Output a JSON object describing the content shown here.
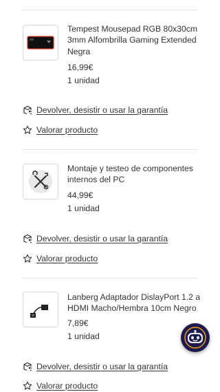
{
  "orders": [
    {
      "name": "Tempest Mousepad RGB 80x30cm 3mm Alfombrilla Gaming Extended Negra",
      "price": "16,99€",
      "quantity": "1 unidad",
      "image": "mousepad-image",
      "return_label": "Devolver, desistir o usar la garantía",
      "review_label": "Valorar producto"
    },
    {
      "name": "Montaje y testeo de componentes internos del PC",
      "price": "44,99€",
      "quantity": "1 unidad",
      "image": "tools-icon",
      "return_label": "Devolver, desistir o usar la garantía",
      "review_label": "Valorar producto"
    },
    {
      "name": "Lanberg Adaptador DislayPort 1.2 a HDMI Macho/Hembra 10cm Negro",
      "price": "7,89€",
      "quantity": "1 unidad",
      "image": "adapter-image",
      "return_label": "Devolver, desistir o usar la garantía",
      "review_label": "Valorar producto"
    }
  ],
  "chat_button": {
    "icon": "robot-assistant-icon"
  },
  "colors": {
    "text": "#333333",
    "divider": "#e2e2e2",
    "fab": "#1d1a4d",
    "fab_ring": "#f4a21c"
  }
}
